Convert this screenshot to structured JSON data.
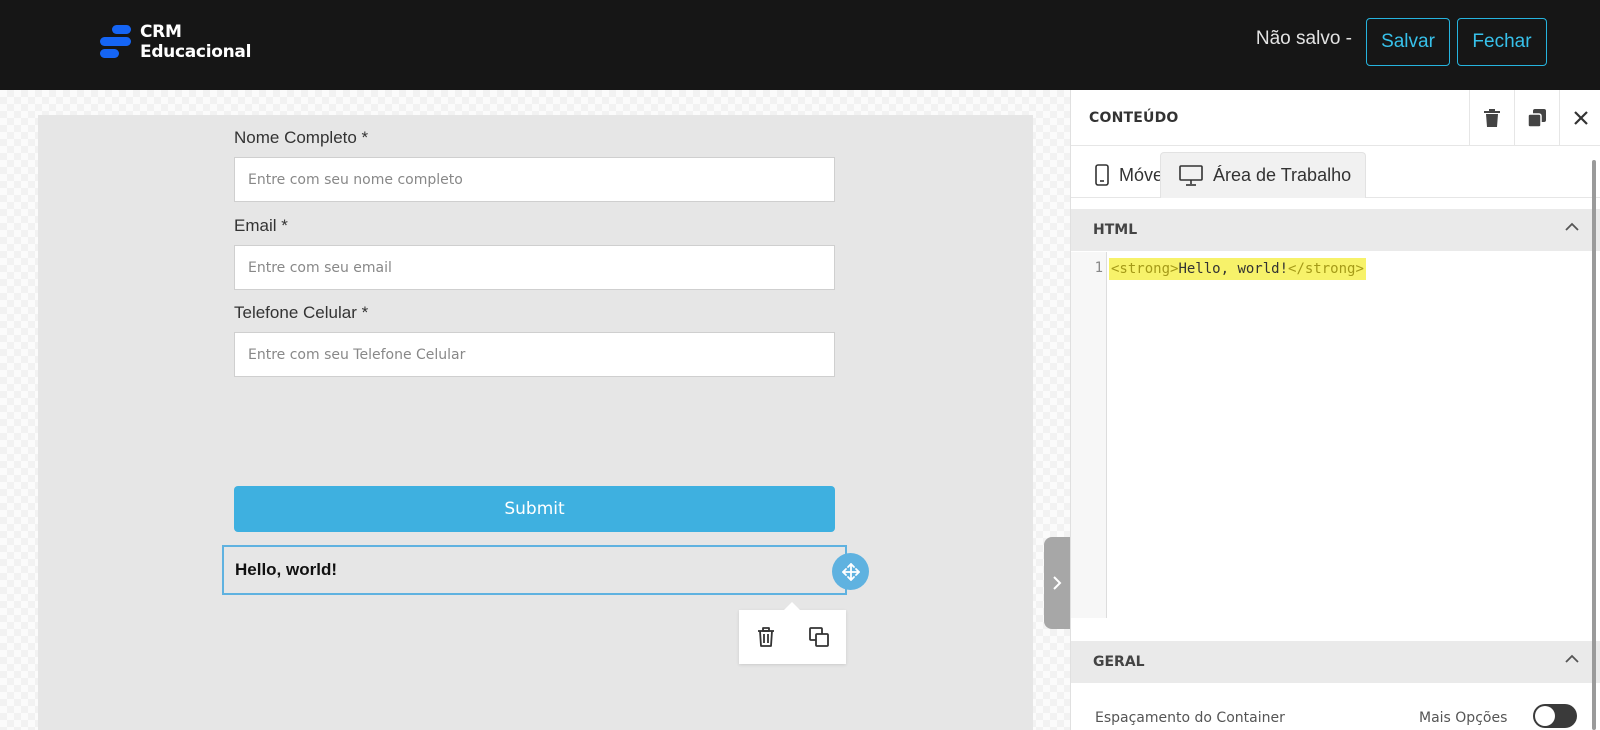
{
  "app": {
    "logo_line1": "CRM",
    "logo_line2": "Educacional",
    "status": "Não salvo -",
    "save_label": "Salvar",
    "close_label": "Fechar",
    "accent_color": "#37c1ea",
    "brand_color": "#1565f5"
  },
  "form": {
    "fields": [
      {
        "label": "Nome Completo *",
        "placeholder": "Entre com seu nome completo"
      },
      {
        "label": "Email *",
        "placeholder": "Entre com seu email"
      },
      {
        "label": "Telefone Celular *",
        "placeholder": "Entre com seu Telefone Celular"
      }
    ],
    "submit_label": "Submit",
    "submit_color": "#3eb0e0",
    "html_block_text": "Hello, world!"
  },
  "panel": {
    "title": "CONTEÚDO",
    "tabs": [
      {
        "label": "Móvel",
        "icon": "phone-icon",
        "active": false
      },
      {
        "label": "Área de Trabalho",
        "icon": "desktop-icon",
        "active": true
      }
    ],
    "html_section": {
      "title": "HTML",
      "line_number": "1",
      "code_open_tag": "<strong>",
      "code_text": "Hello, world!",
      "code_close_tag": "</strong>"
    },
    "general_section": {
      "title": "GERAL",
      "row_label": "Espaçamento do Container",
      "row_right_label": "Mais Opções"
    }
  }
}
